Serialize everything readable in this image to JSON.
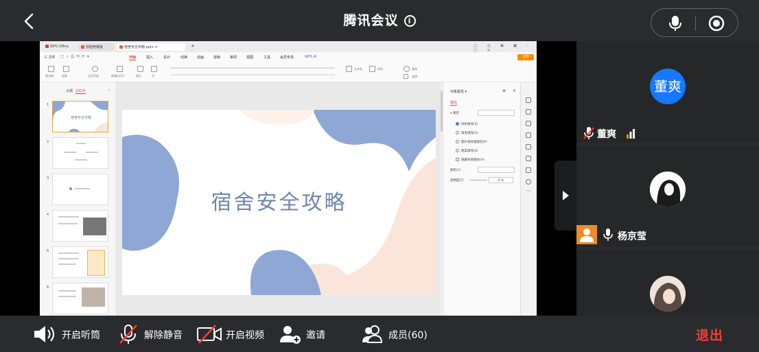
{
  "header": {
    "title": "腾讯会议",
    "info_icon": "info-icon"
  },
  "wps": {
    "tabs": [
      "WPS Office",
      "找稻壳模板",
      "宿舍安全攻略.pptx"
    ],
    "menu": [
      "三 文件",
      "开始",
      "插入",
      "设计",
      "切换",
      "动画",
      "放映",
      "审阅",
      "视图",
      "工具",
      "会员专享",
      "WPS AI"
    ],
    "share_label": "分享",
    "ribbon_labels": [
      "格式刷",
      "粘贴",
      "当页开始",
      "新建幻灯片",
      "版式",
      "节",
      "文本框",
      "排列",
      "查找",
      "选择"
    ],
    "thumb_tabs": [
      "大纲",
      "幻灯片"
    ],
    "slide_numbers": [
      "1",
      "2",
      "3",
      "4",
      "5",
      "6"
    ],
    "slide_title": "宿舍安全攻略",
    "props_title": "对象属性",
    "props_tab": "填充",
    "props_fill_label": "▾ 填充",
    "fill_options": [
      "纯色填充(S)",
      "渐变填充(G)",
      "图片或纹理填充(P)",
      "图案填充(A)",
      "隐藏背景图形(H)"
    ],
    "transparency_label": "透明度(T)",
    "transparency_value": "0",
    "color_label": "颜色(C)"
  },
  "participants": [
    {
      "name": "董爽",
      "avatar_text": "董爽"
    },
    {
      "name": "杨京莹"
    },
    {
      "name": ""
    }
  ],
  "toolbar": {
    "speaker": "开启听筒",
    "unmute": "解除静音",
    "video": "开启视频",
    "invite": "邀请",
    "members": "成员(60)",
    "exit": "退出"
  },
  "colors": {
    "accent": "#1677ff",
    "exit": "#ff3b30",
    "slide_blue": "#8fa7d4",
    "slide_peach": "#fbe5da",
    "host": "#f08a24"
  }
}
